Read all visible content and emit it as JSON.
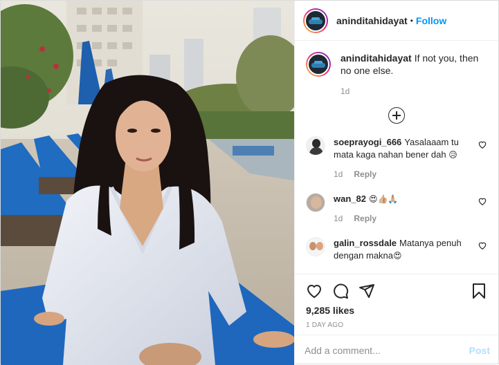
{
  "post": {
    "username": "aninditahidayat",
    "follow_label": "Follow",
    "separator": "•",
    "caption_text": "If not you, then no one else.",
    "caption_time": "1d",
    "load_more_icon": "plus-circle-icon"
  },
  "comments": [
    {
      "user": "soeprayogi_666",
      "text": "Yasalaaam tu mata kaga nahan bener dah",
      "emoji": "😥",
      "time": "1d",
      "reply": "Reply",
      "avatar": "avatar-man-dark"
    },
    {
      "user": "wan_82",
      "text": "",
      "emoji": "😍👍🏼🙏🏼",
      "time": "1d",
      "reply": "Reply",
      "avatar": "avatar-man"
    },
    {
      "user": "galin_rossdale",
      "text": "Matanya penuh dengan makna",
      "emoji": "😍",
      "avatar": "avatar-couple"
    }
  ],
  "actions": {
    "like_icon": "heart-icon",
    "comment_icon": "comment-bubble-icon",
    "share_icon": "paper-plane-icon",
    "save_icon": "bookmark-icon"
  },
  "likes": "9,285 likes",
  "time_ago": "1 DAY AGO",
  "add_comment": {
    "placeholder": "Add a comment...",
    "post_label": "Post"
  },
  "colors": {
    "follow": "#0095f6",
    "post_disabled": "#b2dffc",
    "muted": "#8e8e8e",
    "text": "#262626"
  }
}
